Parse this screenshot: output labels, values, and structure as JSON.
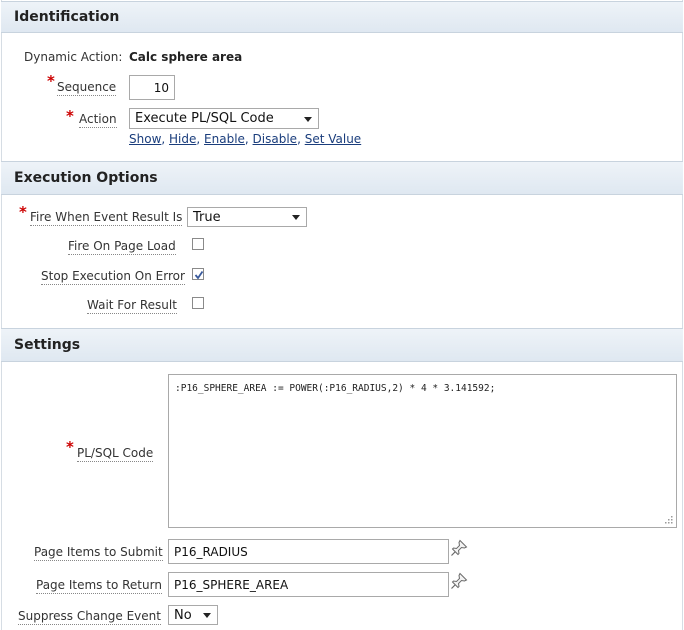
{
  "identification": {
    "header": "Identification",
    "dynamic_action_label": "Dynamic Action:",
    "dynamic_action_value": "Calc sphere area",
    "sequence_label": "Sequence",
    "sequence_value": "10",
    "action_label": "Action",
    "action_value": "Execute PL/SQL Code",
    "quick_links": [
      "Show",
      "Hide",
      "Enable",
      "Disable",
      "Set Value"
    ]
  },
  "execution_options": {
    "header": "Execution Options",
    "fire_when_label": "Fire When Event Result Is",
    "fire_when_value": "True",
    "fire_on_page_load_label": "Fire On Page Load",
    "fire_on_page_load_checked": false,
    "stop_execution_label": "Stop Execution On Error",
    "stop_execution_checked": true,
    "wait_for_result_label": "Wait For Result",
    "wait_for_result_checked": false
  },
  "settings": {
    "header": "Settings",
    "plsql_code_label": "PL/SQL Code",
    "plsql_code_value": ":P16_SPHERE_AREA := POWER(:P16_RADIUS,2) * 4 * 3.141592;",
    "page_items_submit_label": "Page Items to Submit",
    "page_items_submit_value": "P16_RADIUS",
    "page_items_return_label": "Page Items to Return",
    "page_items_return_value": "P16_SPHERE_AREA",
    "suppress_change_label": "Suppress Change Event",
    "suppress_change_value": "No"
  },
  "icons": {
    "required_marker": "*",
    "pin_icon": "pushpin-icon",
    "checkmark": "check-icon",
    "dropdown": "chevron-down-icon",
    "resize": "resize-grip-icon"
  },
  "colors": {
    "header_bg": "#e4ebf3",
    "required": "#cc0000",
    "link": "#1a3d7c",
    "check": "#3a5a9c"
  }
}
